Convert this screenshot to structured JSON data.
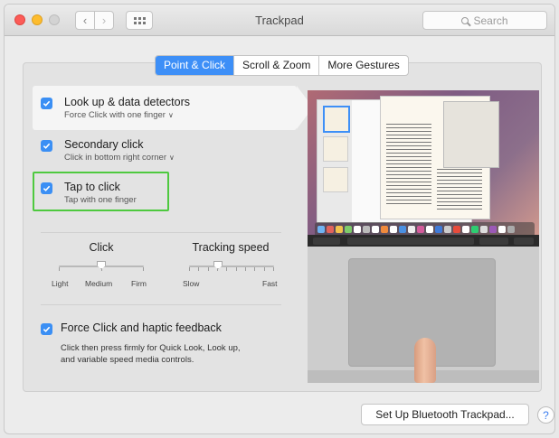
{
  "window": {
    "title": "Trackpad"
  },
  "search": {
    "placeholder": "Search"
  },
  "tabs": [
    {
      "label": "Point & Click",
      "active": true
    },
    {
      "label": "Scroll & Zoom",
      "active": false
    },
    {
      "label": "More Gestures",
      "active": false
    }
  ],
  "options": [
    {
      "title": "Look up & data detectors",
      "subtitle": "Force Click with one finger",
      "checked": true,
      "has_menu": true
    },
    {
      "title": "Secondary click",
      "subtitle": "Click in bottom right corner",
      "checked": true,
      "has_menu": true
    },
    {
      "title": "Tap to click",
      "subtitle": "Tap with one finger",
      "checked": true,
      "has_menu": false
    }
  ],
  "click_slider": {
    "label": "Click",
    "min_label": "Light",
    "mid_label": "Medium",
    "max_label": "Firm",
    "value_position": "Medium"
  },
  "tracking_slider": {
    "label": "Tracking speed",
    "min_label": "Slow",
    "max_label": "Fast",
    "value_fraction": 0.33
  },
  "force_click": {
    "title": "Force Click and haptic feedback",
    "description_line1": "Click then press firmly for Quick Look, Look up,",
    "description_line2": "and variable speed media controls.",
    "checked": true
  },
  "footer": {
    "setup_button": "Set Up Bluetooth Trackpad...",
    "help": "?"
  },
  "colors": {
    "accent": "#3d8ff7",
    "highlight_box": "#4ec93f"
  }
}
